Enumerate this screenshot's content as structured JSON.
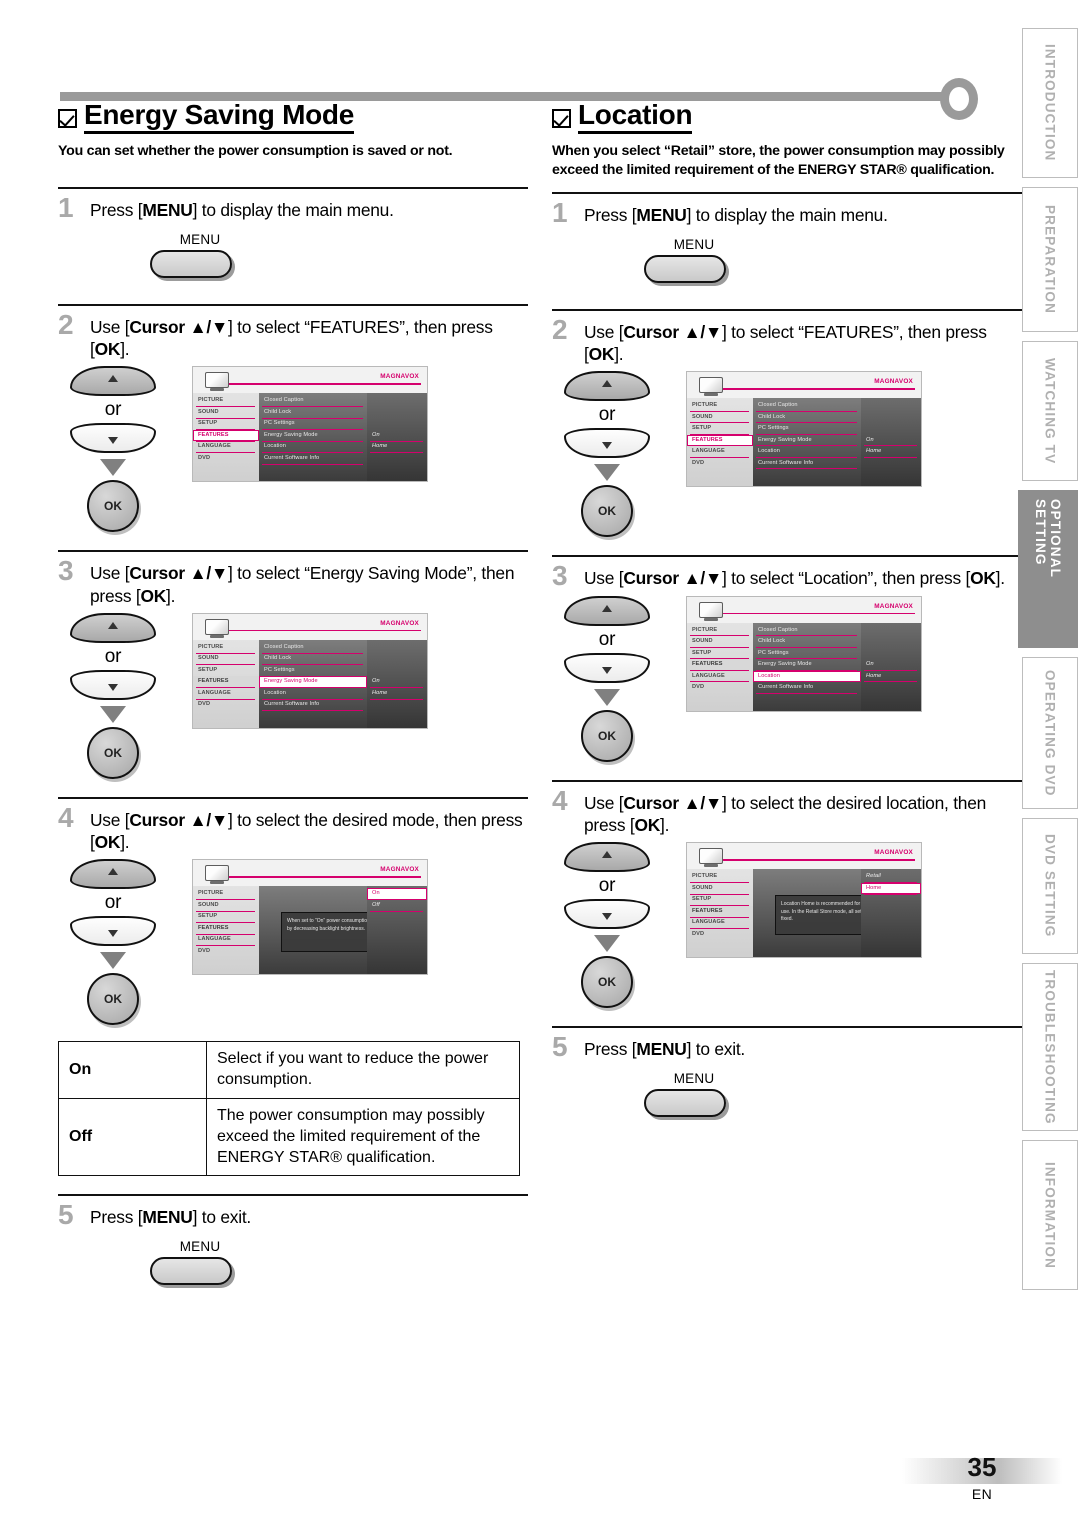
{
  "page": {
    "number": "35",
    "lang_code": "EN"
  },
  "sidebar": {
    "items": [
      {
        "label": "INTRODUCTION",
        "active": false
      },
      {
        "label": "PREPARATION",
        "active": false
      },
      {
        "label": "WATCHING TV",
        "active": false
      },
      {
        "label": "OPTIONAL SETTING",
        "active": true
      },
      {
        "label": "OPERATING DVD",
        "active": false
      },
      {
        "label": "DVD SETTING",
        "active": false
      },
      {
        "label": "TROUBLESHOOTING",
        "active": false
      },
      {
        "label": "INFORMATION",
        "active": false
      }
    ]
  },
  "left": {
    "title": "Energy Saving Mode",
    "description": "You can set whether the power consumption is saved or not.",
    "steps": [
      {
        "num": "1",
        "text_html": "Press [<b>MENU</b>] to display the main menu."
      },
      {
        "num": "2",
        "text_html": "Use [<b>Cursor ▲/▼</b>] to select “FEATURES”, then press [<b>OK</b>]."
      },
      {
        "num": "3",
        "text_html": "Use [<b>Cursor ▲/▼</b>] to select “Energy Saving Mode”, then press [<b>OK</b>]."
      },
      {
        "num": "4",
        "text_html": "Use [<b>Cursor ▲/▼</b>] to select the desired mode, then press [<b>OK</b>]."
      },
      {
        "num": "5",
        "text_html": "Press [<b>MENU</b>] to exit."
      }
    ],
    "table": {
      "rows": [
        {
          "key": "On",
          "value": "Select if you want to reduce the power consumption."
        },
        {
          "key": "Off",
          "value": "The power consumption may possibly exceed the limited requirement of the ENERGY STAR® qualification."
        }
      ]
    }
  },
  "right": {
    "title": "Location",
    "description": "When you select “Retail” store, the power consumption may possibly exceed the limited requirement of the ENERGY STAR® qualification.",
    "steps": [
      {
        "num": "1",
        "text_html": "Press [<b>MENU</b>] to display the main menu."
      },
      {
        "num": "2",
        "text_html": "Use [<b>Cursor ▲/▼</b>] to select “FEATURES”, then press [<b>OK</b>]."
      },
      {
        "num": "3",
        "text_html": "Use [<b>Cursor ▲/▼</b>] to select “Location”, then press [<b>OK</b>]."
      },
      {
        "num": "4",
        "text_html": "Use [<b>Cursor ▲/▼</b>] to select the desired location, then press [<b>OK</b>]."
      },
      {
        "num": "5",
        "text_html": "Press [<b>MENU</b>] to exit."
      }
    ]
  },
  "remote": {
    "menu_key_label": "MENU",
    "ok_label": "OK",
    "or_label": "or"
  },
  "osd": {
    "brand": "MAGNAVOX",
    "categories": [
      "PICTURE",
      "SOUND",
      "SETUP",
      "FEATURES",
      "LANGUAGE",
      "DVD"
    ],
    "feature_items": [
      "Closed Caption",
      "Child Lock",
      "PC Settings",
      "Energy Saving Mode",
      "Location",
      "Current Software Info"
    ],
    "values": {
      "energy_saving_mode": "On",
      "location": "Home"
    },
    "mode_options": [
      "On",
      "Off"
    ],
    "location_options": [
      "Retail",
      "Home"
    ],
    "tip_energy": "When set to “On” power consumption is reduced by decreasing backlight brightness.",
    "tip_location": "Location Home is recommended for normal home use. In the Retail Store mode, all settings are fixed.",
    "accent_color": "#d5006d"
  }
}
